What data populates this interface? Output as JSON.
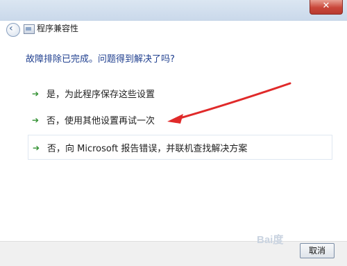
{
  "window": {
    "title": "程序兼容性",
    "close_symbol": "✕"
  },
  "header": {
    "question": "故障排除已完成。问题得到解决了吗?"
  },
  "options": [
    {
      "label": "是，为此程序保存这些设置"
    },
    {
      "label": "否，使用其他设置再试一次"
    },
    {
      "label": "否，向 Microsoft 报告错误，并联机查找解决方案"
    }
  ],
  "footer": {
    "cancel_label": "取消"
  },
  "watermark": "Bai度",
  "colors": {
    "title_blue": "#1f3f8f",
    "arrow_green": "#2f8f2f",
    "annotation_red": "#e02a2a"
  }
}
